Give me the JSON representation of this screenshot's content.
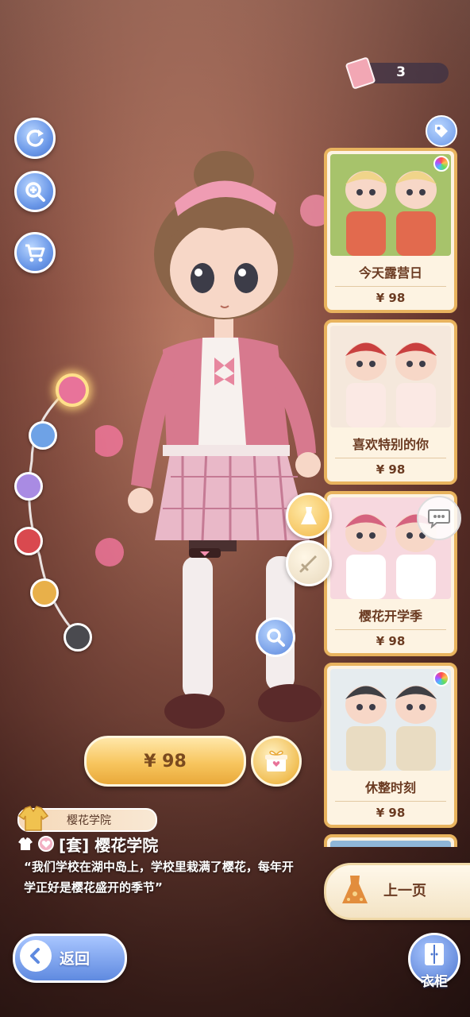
{
  "currency": {
    "count": "3",
    "icon": "ticket-icon"
  },
  "left_toolbar": [
    {
      "name": "rotate-icon"
    },
    {
      "name": "zoom-in-icon"
    },
    {
      "name": "shopping-cart-icon"
    }
  ],
  "color_swatches": [
    {
      "color": "#e8739a",
      "selected": true
    },
    {
      "color": "#6ea2e6",
      "selected": false
    },
    {
      "color": "#a98be3",
      "selected": false
    },
    {
      "color": "#d9494f",
      "selected": false
    },
    {
      "color": "#e8b04a",
      "selected": false
    },
    {
      "color": "#4a4a4f",
      "selected": false
    }
  ],
  "outfit_cards": [
    {
      "name": "今天露营日",
      "price": "¥ 98",
      "rainbow": true,
      "palette": [
        "#a7c36b",
        "#f0d48a",
        "#e26a4e"
      ]
    },
    {
      "name": "喜欢特别的你",
      "price": "¥ 98",
      "rainbow": false,
      "palette": [
        "#f5e8dc",
        "#c9403f",
        "#fbe9e4"
      ]
    },
    {
      "name": "樱花开学季",
      "price": "¥ 98",
      "rainbow": false,
      "palette": [
        "#f7d8df",
        "#d5637f",
        "#ffffff"
      ]
    },
    {
      "name": "休整时刻",
      "price": "¥ 98",
      "rainbow": true,
      "palette": [
        "#e6ecef",
        "#3f3f44",
        "#e9dcc2"
      ]
    }
  ],
  "price_button": {
    "label": "¥ 98"
  },
  "set_info": {
    "tag": "樱花学院",
    "title": "[套] 樱花学院",
    "description": "“我们学校在湖中岛上，学校里栽满了樱花，每年开学正好是樱花盛开的季节”"
  },
  "prev_page": {
    "label": "上一页"
  },
  "back": {
    "label": "返回"
  },
  "wardrobe": {
    "label": "衣柜"
  },
  "colors": {
    "accent_gold": "#e8b35e",
    "button_blue": "#6b98e8",
    "pink": "#e8739a"
  }
}
